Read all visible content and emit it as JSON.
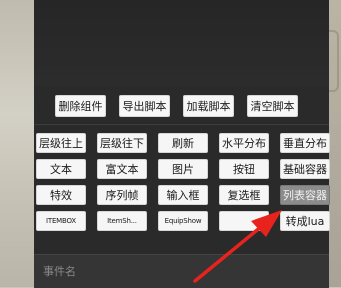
{
  "toolbar_row1": [
    {
      "label": "删除组件"
    },
    {
      "label": "导出脚本"
    },
    {
      "label": "加载脚本"
    },
    {
      "label": "清空脚本"
    }
  ],
  "component_grid": [
    {
      "label": "层级往上"
    },
    {
      "label": "层级往下"
    },
    {
      "label": "刷新"
    },
    {
      "label": "水平分布"
    },
    {
      "label": "垂直分布"
    },
    {
      "label": "文本"
    },
    {
      "label": "富文本"
    },
    {
      "label": "图片"
    },
    {
      "label": "按钮"
    },
    {
      "label": "基础容器"
    },
    {
      "label": "特效"
    },
    {
      "label": "序列帧"
    },
    {
      "label": "输入框"
    },
    {
      "label": "复选框"
    },
    {
      "label": "列表容器"
    },
    {
      "label": "ITEMBOX"
    },
    {
      "label": "ItemSh..."
    },
    {
      "label": "EquipShow"
    },
    {
      "label": ""
    },
    {
      "label": "转成lua"
    }
  ],
  "footer": {
    "label": "事件名"
  },
  "colors": {
    "panel": "#2a2a2a",
    "button": "#f6f6f6",
    "selected": "#8c8c8c",
    "arrow": "#e8231d"
  }
}
